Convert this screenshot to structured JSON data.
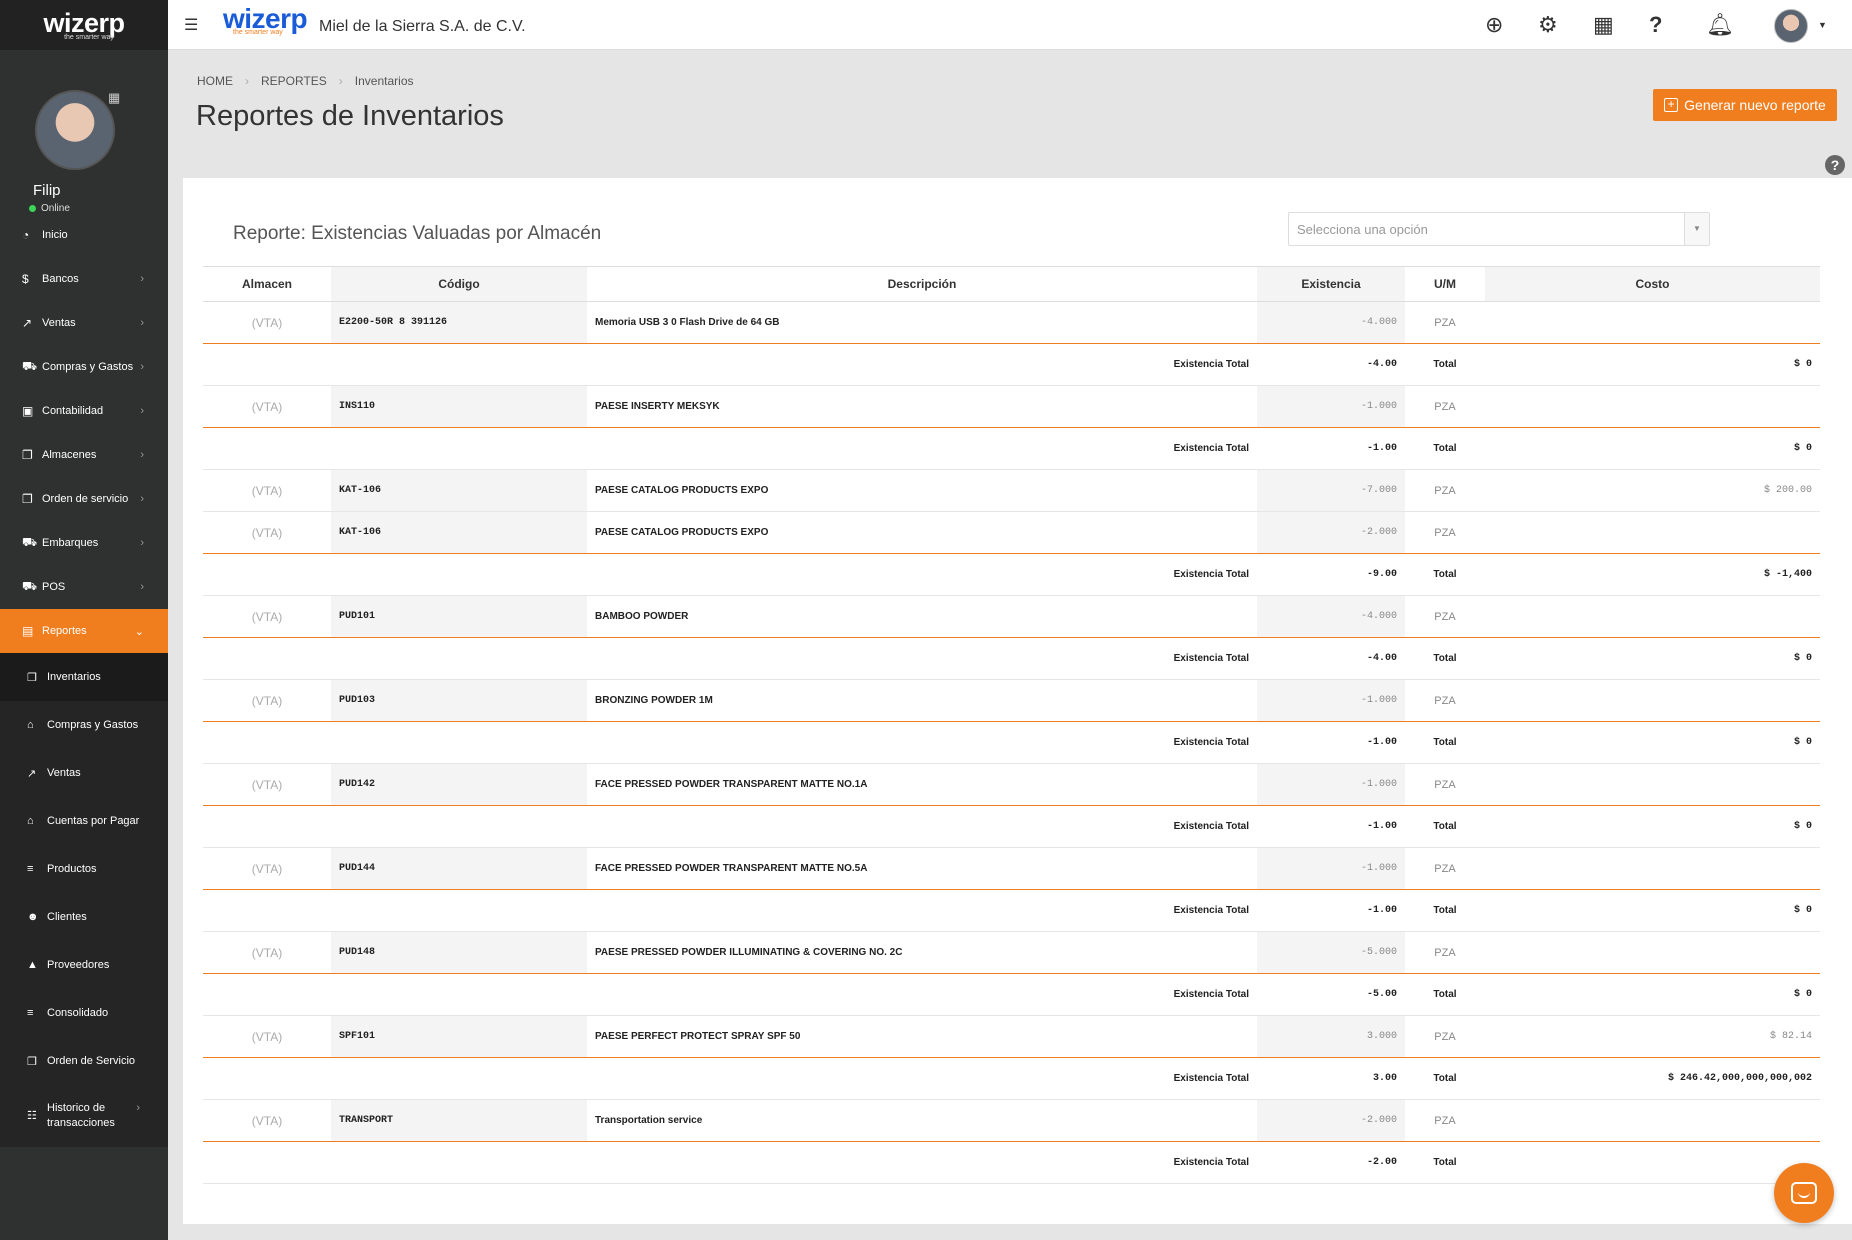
{
  "sidebar": {
    "logo": "wizerp",
    "tagline": "the smarter way",
    "user_name": "Filip",
    "user_status": "Online",
    "items": [
      {
        "label": "Inicio",
        "icon": "dashboard-icon",
        "glyph": "◔",
        "chevron": false
      },
      {
        "label": "Bancos",
        "icon": "dollar-icon",
        "glyph": "$",
        "chevron": true
      },
      {
        "label": "Ventas",
        "icon": "line-chart-icon",
        "glyph": "↗",
        "chevron": true
      },
      {
        "label": "Compras y Gastos",
        "icon": "cart-icon",
        "glyph": "⛟",
        "chevron": true
      },
      {
        "label": "Contabilidad",
        "icon": "money-icon",
        "glyph": "▣",
        "chevron": true
      },
      {
        "label": "Almacenes",
        "icon": "copy-icon",
        "glyph": "❐",
        "chevron": true
      },
      {
        "label": "Orden de servicio",
        "icon": "copy-icon",
        "glyph": "❐",
        "chevron": true
      },
      {
        "label": "Embarques",
        "icon": "truck-icon",
        "glyph": "⛟",
        "chevron": true
      },
      {
        "label": "POS",
        "icon": "cart-icon",
        "glyph": "⛟",
        "chevron": true
      },
      {
        "label": "Reportes",
        "icon": "list-alt-icon",
        "glyph": "▤",
        "chevron": true,
        "active": true
      }
    ],
    "subitems": [
      {
        "label": "Inventarios",
        "icon": "copy-icon",
        "glyph": "❐",
        "current": true
      },
      {
        "label": "Compras y Gastos",
        "icon": "bank-icon",
        "glyph": "⌂"
      },
      {
        "label": "Ventas",
        "icon": "line-chart-icon",
        "glyph": "↗"
      },
      {
        "label": "Cuentas por Pagar",
        "icon": "bank-icon",
        "glyph": "⌂"
      },
      {
        "label": "Productos",
        "icon": "bars-icon",
        "glyph": "≡"
      },
      {
        "label": "Clientes",
        "icon": "users-icon",
        "glyph": "☻"
      },
      {
        "label": "Proveedores",
        "icon": "lock-icon",
        "glyph": "▲"
      },
      {
        "label": "Consolidado",
        "icon": "bars-icon",
        "glyph": "≡"
      },
      {
        "label": "Orden de Servicio",
        "icon": "copy-icon",
        "glyph": "❐"
      },
      {
        "label_line1": "Historico de",
        "label_line2": "transacciones",
        "icon": "list-icon",
        "glyph": "☷",
        "chevron": true
      }
    ]
  },
  "topbar": {
    "logo": "wizerp",
    "tagline": "the smarter way",
    "company": "Miel de la Sierra S.A. de C.V."
  },
  "breadcrumb": [
    "HOME",
    "REPORTES",
    "Inventarios"
  ],
  "page_title": "Reportes de Inventarios",
  "generate_button": "Generar nuevo reporte",
  "report": {
    "title": "Reporte: Existencias Valuadas por Almacén",
    "select_placeholder": "Selecciona una opción",
    "columns": [
      "Almacen",
      "Código",
      "Descripción",
      "Existencia",
      "U/M",
      "Costo"
    ],
    "total_label": "Existencia Total",
    "total_word": "Total",
    "groups": [
      {
        "rows": [
          {
            "alm": "(VTA)",
            "code": "E2200-50R 8 391126",
            "desc": "Memoria USB 3 0 Flash Drive de 64 GB",
            "ex": "-4.000",
            "um": "PZA",
            "cost": ""
          }
        ],
        "total_ex": "-4.00",
        "total_cost": "$ 0"
      },
      {
        "rows": [
          {
            "alm": "(VTA)",
            "code": "INS110",
            "desc": "PAESE INSERTY MEKSYK",
            "ex": "-1.000",
            "um": "PZA",
            "cost": ""
          }
        ],
        "total_ex": "-1.00",
        "total_cost": "$ 0"
      },
      {
        "rows": [
          {
            "alm": "(VTA)",
            "code": "KAT-106",
            "desc": "PAESE CATALOG PRODUCTS EXPO",
            "ex": "-7.000",
            "um": "PZA",
            "cost": "$ 200.00"
          },
          {
            "alm": "(VTA)",
            "code": "KAT-106",
            "desc": "PAESE CATALOG PRODUCTS EXPO",
            "ex": "-2.000",
            "um": "PZA",
            "cost": ""
          }
        ],
        "total_ex": "-9.00",
        "total_cost": "$ -1,400"
      },
      {
        "rows": [
          {
            "alm": "(VTA)",
            "code": "PUD101",
            "desc": "BAMBOO POWDER",
            "ex": "-4.000",
            "um": "PZA",
            "cost": ""
          }
        ],
        "total_ex": "-4.00",
        "total_cost": "$ 0"
      },
      {
        "rows": [
          {
            "alm": "(VTA)",
            "code": "PUD103",
            "desc": "BRONZING POWDER 1M",
            "ex": "-1.000",
            "um": "PZA",
            "cost": ""
          }
        ],
        "total_ex": "-1.00",
        "total_cost": "$ 0"
      },
      {
        "rows": [
          {
            "alm": "(VTA)",
            "code": "PUD142",
            "desc": "FACE PRESSED POWDER TRANSPARENT MATTE NO.1A",
            "ex": "-1.000",
            "um": "PZA",
            "cost": ""
          }
        ],
        "total_ex": "-1.00",
        "total_cost": "$ 0"
      },
      {
        "rows": [
          {
            "alm": "(VTA)",
            "code": "PUD144",
            "desc": "FACE PRESSED POWDER TRANSPARENT MATTE NO.5A",
            "ex": "-1.000",
            "um": "PZA",
            "cost": ""
          }
        ],
        "total_ex": "-1.00",
        "total_cost": "$ 0"
      },
      {
        "rows": [
          {
            "alm": "(VTA)",
            "code": "PUD148",
            "desc": "PAESE PRESSED POWDER ILLUMINATING & COVERING NO. 2C",
            "ex": "-5.000",
            "um": "PZA",
            "cost": ""
          }
        ],
        "total_ex": "-5.00",
        "total_cost": "$ 0"
      },
      {
        "rows": [
          {
            "alm": "(VTA)",
            "code": "SPF101",
            "desc": "PAESE PERFECT PROTECT SPRAY SPF 50",
            "ex": "3.000",
            "um": "PZA",
            "cost": "$ 82.14"
          }
        ],
        "total_ex": "3.00",
        "total_cost": "$ 246.42,000,000,000,002"
      },
      {
        "rows": [
          {
            "alm": "(VTA)",
            "code": "TRANSPORT",
            "desc": "Transportation service",
            "ex": "-2.000",
            "um": "PZA",
            "cost": ""
          }
        ],
        "total_ex": "-2.00",
        "total_cost": ""
      }
    ]
  }
}
